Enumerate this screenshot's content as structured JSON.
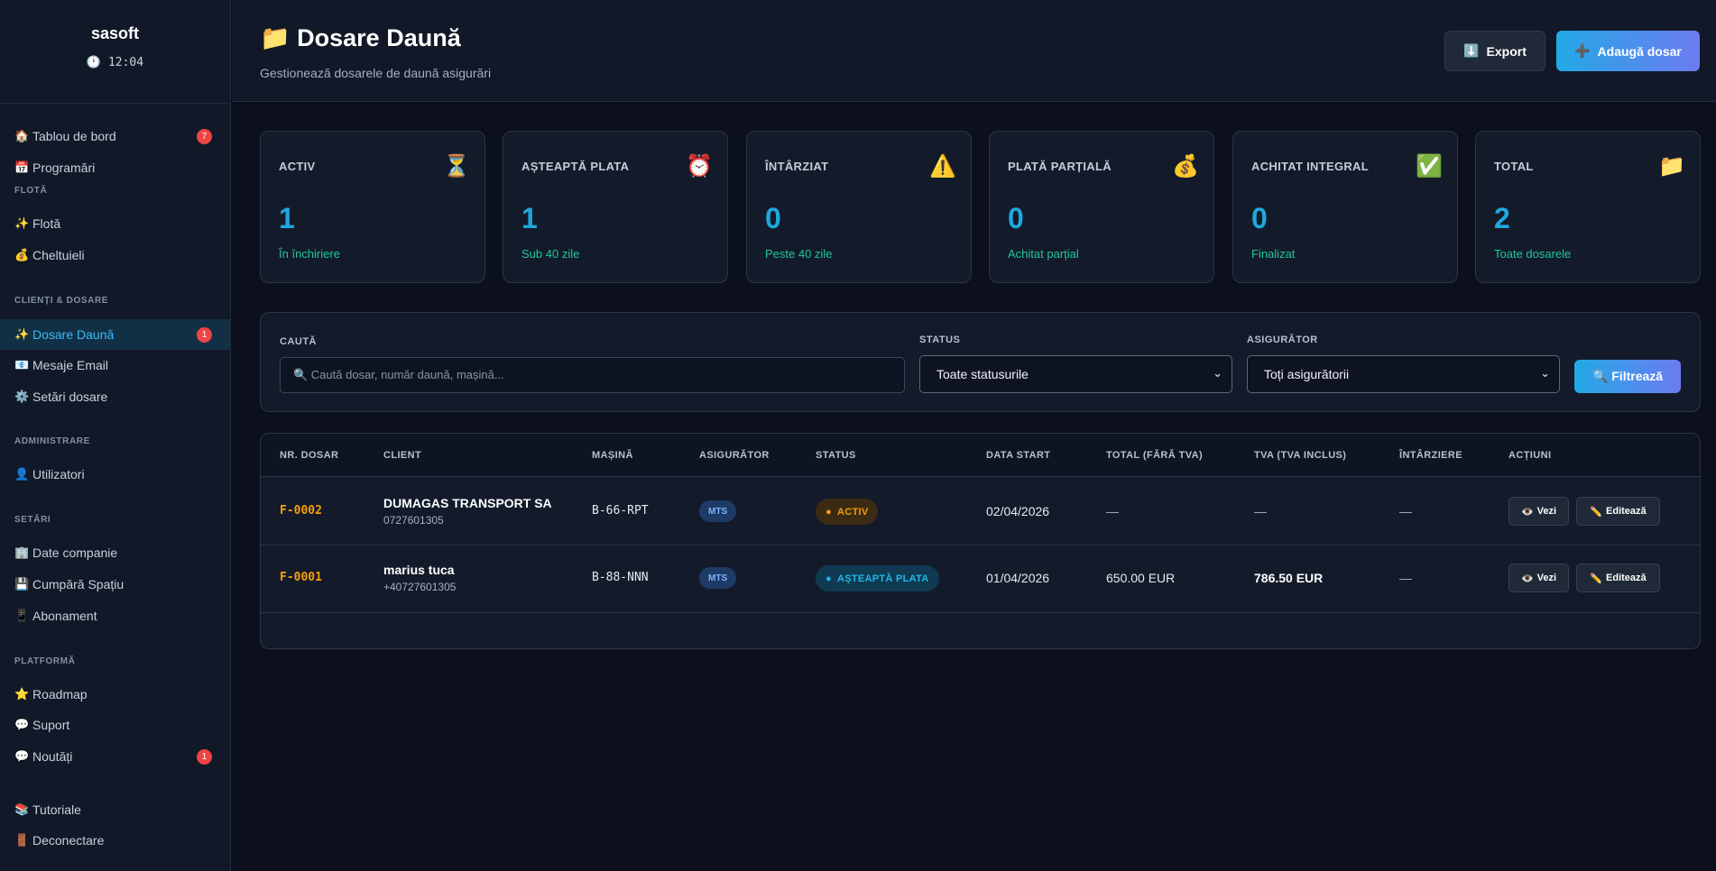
{
  "sidebar": {
    "brand": "sasoft",
    "clock_icon": "🕐",
    "time": "12:04",
    "items": [
      {
        "icon": "🏠",
        "label": "Tablou de bord",
        "badge": "7"
      },
      {
        "icon": "📅",
        "label": "Programări"
      },
      {
        "icon": "✨",
        "label": "Flotă"
      },
      {
        "icon": "💰",
        "label": "Cheltuieli"
      },
      {
        "icon": "✨",
        "label": "Dosare Daună",
        "badge": "1"
      },
      {
        "icon": "📧",
        "label": "Mesaje Email"
      },
      {
        "icon": "⚙️",
        "label": "Setări dosare"
      },
      {
        "icon": "👤",
        "label": "Utilizatori"
      },
      {
        "icon": "🏢",
        "label": "Date companie"
      },
      {
        "icon": "💾",
        "label": "Cumpără Spațiu"
      },
      {
        "icon": "📱",
        "label": "Abonament"
      },
      {
        "icon": "⭐",
        "label": "Roadmap"
      },
      {
        "icon": "💬",
        "label": "Suport"
      },
      {
        "icon": "💬",
        "label": "Noutăți",
        "badge": "1"
      },
      {
        "icon": "📚",
        "label": "Tutoriale"
      },
      {
        "icon": "🚪",
        "label": "Deconectare"
      }
    ],
    "sections": [
      "FLOTĂ",
      "CLIENȚI & DOSARE",
      "ADMINISTRARE",
      "SETĂRI",
      "PLATFORMĂ"
    ]
  },
  "header": {
    "title_icon": "📁",
    "title": "Dosare Daună",
    "subtitle": "Gestionează dosarele de daună asigurări",
    "export_icon": "⬇️",
    "export_label": "Export",
    "add_icon": "➕",
    "add_label": "Adaugă dosar"
  },
  "stats": [
    {
      "label": "ACTIV",
      "icon": "⏳",
      "value": "1",
      "note": "În închiriere"
    },
    {
      "label": "AȘTEAPTĂ PLATA",
      "icon": "⏰",
      "value": "1",
      "note": "Sub 40 zile"
    },
    {
      "label": "ÎNTÂRZIAT",
      "icon": "⚠️",
      "value": "0",
      "note": "Peste 40 zile"
    },
    {
      "label": "PLATĂ PARȚIALĂ",
      "icon": "💰",
      "value": "0",
      "note": "Achitat parțial"
    },
    {
      "label": "ACHITAT INTEGRAL",
      "icon": "✅",
      "value": "0",
      "note": "Finalizat"
    },
    {
      "label": "TOTAL",
      "icon": "📁",
      "value": "2",
      "note": "Toate dosarele"
    }
  ],
  "filters": {
    "search_label": "CAUTĂ",
    "search_placeholder": "🔍 Caută dosar, număr daună, mașină...",
    "status_label": "STATUS",
    "status_value": "Toate statusurile",
    "insurer_label": "ASIGURĂTOR",
    "insurer_value": "Toți asigurătorii",
    "filter_label": "🔍 Filtrează"
  },
  "table": {
    "columns": [
      "NR. DOSAR",
      "CLIENT",
      "MAȘINĂ",
      "ASIGURĂTOR",
      "STATUS",
      "DATA START",
      "TOTAL (FĂRĂ TVA)",
      "TVA (TVA INCLUS)",
      "ÎNTÂRZIERE",
      "ACȚIUNI"
    ],
    "rows": [
      {
        "id": "F-0002",
        "client": "DUMAGAS TRANSPORT SA",
        "phone": "0727601305",
        "car": "B-66-RPT",
        "insurer": "MTS",
        "status": "ACTIV",
        "start": "02/04/2026",
        "total": "—",
        "tva": "—",
        "delay": "—"
      },
      {
        "id": "F-0001",
        "client": "marius tuca",
        "phone": "+40727601305",
        "car": "B-88-NNN",
        "insurer": "MTS",
        "status": "AȘTEAPTĂ PLATA",
        "start": "01/04/2026",
        "total": "650.00 EUR",
        "tva": "786.50 EUR",
        "delay": "—"
      }
    ],
    "view_icon": "👁️",
    "view_label": "Vezi",
    "edit_icon": "✏️",
    "edit_label": "Editează"
  }
}
